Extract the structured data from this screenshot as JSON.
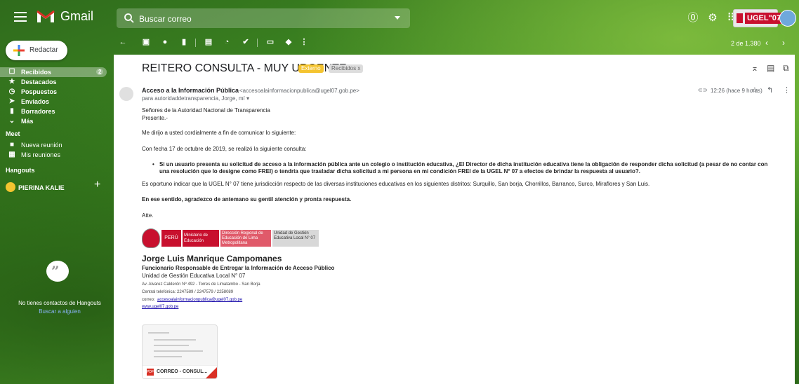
{
  "app": {
    "name": "Gmail"
  },
  "search": {
    "placeholder": "Buscar correo"
  },
  "account": {
    "badge": "UGEL\"07"
  },
  "sidebar": {
    "compose_label": "Redactar",
    "items": [
      {
        "label": "Recibidos",
        "count": "2",
        "icon": "inbox-icon"
      },
      {
        "label": "Destacados",
        "icon": "star-icon"
      },
      {
        "label": "Pospuestos",
        "icon": "clock-icon"
      },
      {
        "label": "Enviados",
        "icon": "send-icon"
      },
      {
        "label": "Borradores",
        "icon": "draft-icon"
      },
      {
        "label": "Más",
        "icon": "chevron-down-icon"
      }
    ],
    "meet": {
      "title": "Meet",
      "items": [
        {
          "label": "Nueva reunión",
          "icon": "video-icon"
        },
        {
          "label": "Mis reuniones",
          "icon": "calendar-icon"
        }
      ]
    },
    "hangouts": {
      "title": "Hangouts",
      "user": "PIERINA KALIE",
      "empty_text": "No tienes contactos de Hangouts",
      "find_link": "Buscar a alguien"
    }
  },
  "toolbar": {
    "pager": "2 de 1.380"
  },
  "email": {
    "subject": "REITERO CONSULTA - MUY URGENTE",
    "labels": [
      "Externo",
      "Recibidos x"
    ],
    "sender_name": "Acceso a la Información Pública",
    "sender_email": "<accesoalainformacionpublica@ugel07.gob.pe>",
    "to_line": "para autoridaddetransparencia, Jorge, mí ▾",
    "time": "12:26 (hace 9 horas)",
    "body": {
      "greeting1": "Señores de la Autoridad Nacional de Transparencia",
      "greeting2": "Presente.-",
      "p1": "Me dirijo a usted cordialmente a fin de comunicar lo siguiente:",
      "p2": "Con fecha 17 de octubre de 2019, se realizó la siguiente consulta:",
      "bullet": "Si un usuario presenta su solicitud de acceso a la información pública ante un colegio o institución educativa, ¿El Director de dicha institución educativa tiene la obligación de responder dicha solicitud (a pesar de no contar con una resolución que lo designe como FREI) o tendría que trasladar dicha solicitud a mi persona en mi condición FREI de la UGEL N° 07 a efectos de  brindar la respuesta al usuario?.",
      "p3": "Es oportuno indicar que la UGEL N° 07 tiene jurisdicción respecto de las diversas instituciones educativas en los siguientes distritos: Surquillo, San borja, Chorrillos, Barranco, Surco, Miraflores y San Luis.",
      "p4": "En ese sentido, agradezco de antemano su gentil atención y pronta respuesta.",
      "closing": "Atte."
    },
    "signature": {
      "logo_peru": "PERÚ",
      "logo_ministerio": "Ministerio de Educación",
      "logo_direccion": "Dirección Regional de Educación de Lima Metropolitana",
      "logo_ugel": "Unidad de Gestión Educativa Local N° 07",
      "name": "Jorge Luis Manrique Campomanes",
      "role": "Funcionario Responsable de Entregar la Información de Acceso Público",
      "org": "Unidad de Gestión Educativa Local N° 07",
      "address": "Av. Alvarez Calderón Nº 492 - Torres de Limatambo - San Borja",
      "phone": "Central telefónica: 2247589 / 2247579 / 2258089",
      "email_label": "correo:",
      "email": "accesoalainformacionpublica@ugel07.gob.pe",
      "web": "www.ugel07.gob.pe"
    },
    "attachment": {
      "name": "CORREO - CONSUL...",
      "type": "PDF"
    }
  },
  "colors": {
    "gmail_red": "#d93025",
    "peru_red": "#c8102e",
    "label_yellow": "#f4c430"
  }
}
